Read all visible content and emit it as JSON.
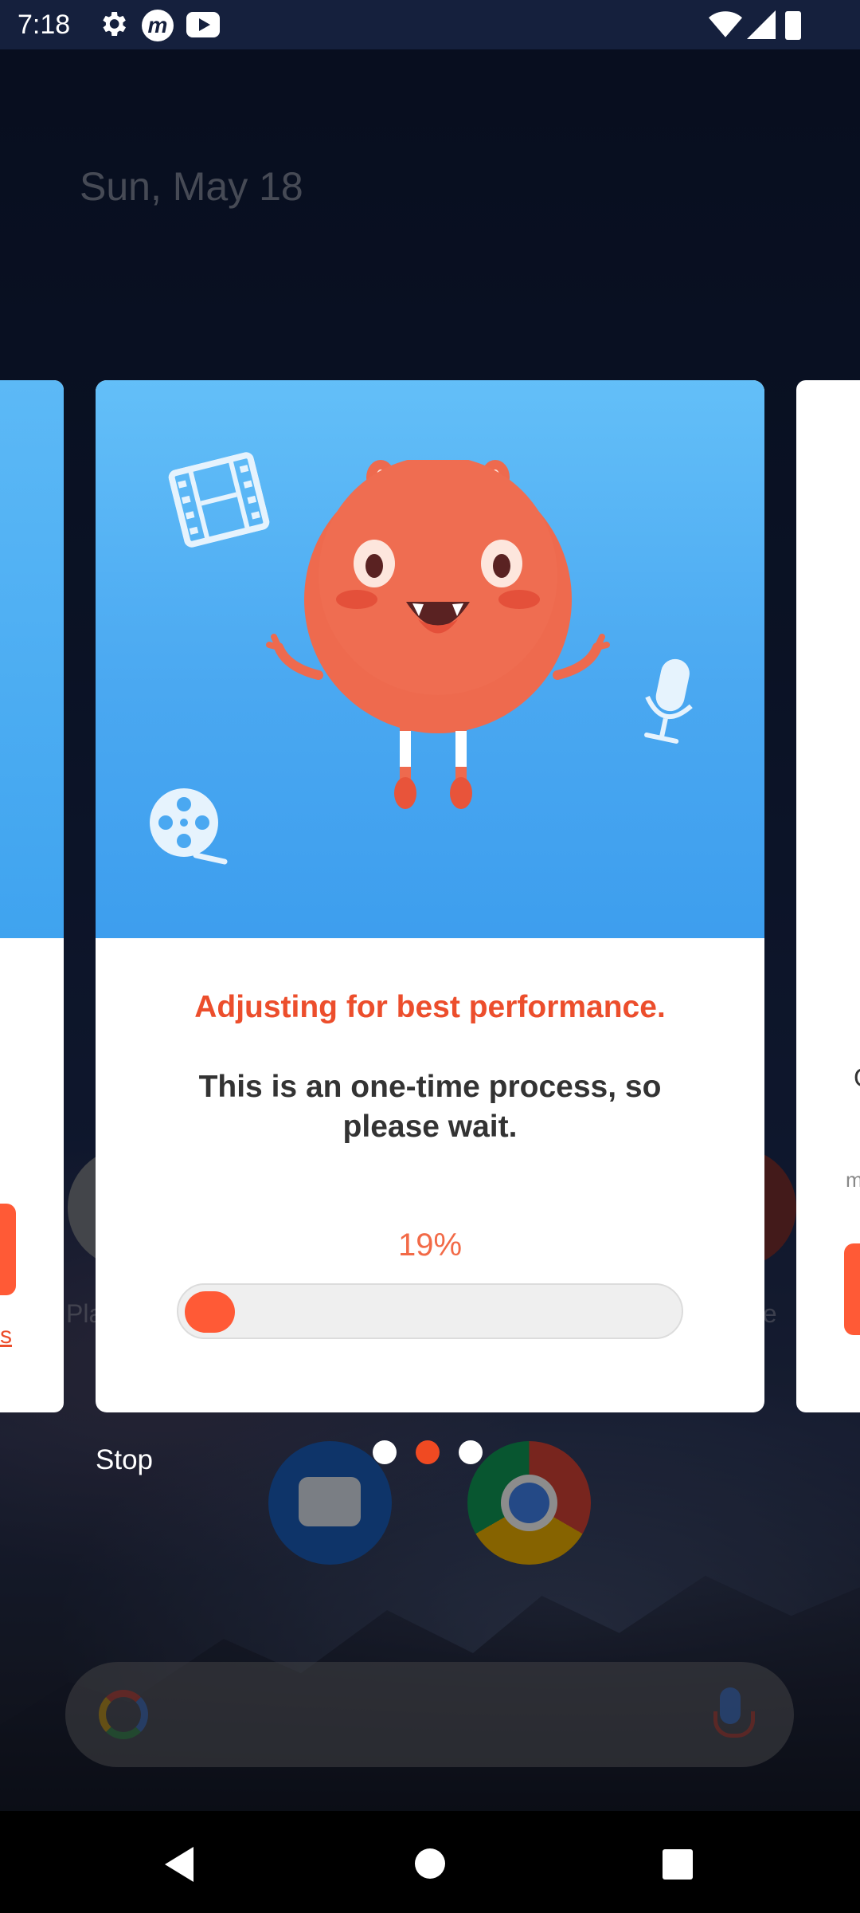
{
  "status_bar": {
    "time": "7:18",
    "icons": [
      "gear-icon",
      "messenger-m-icon",
      "youtube-icon",
      "wifi-icon",
      "signal-icon",
      "battery-icon"
    ]
  },
  "home": {
    "date": "Sun, May 18",
    "left_label_fragment": "Pla",
    "right_label_fragment": "be"
  },
  "left_card": {
    "link_fragment": "s"
  },
  "right_card": {
    "text_fragment": "C",
    "text_fragment_2": "m"
  },
  "dialog": {
    "headline": "Adjusting for best performance.",
    "subtext": "This is an one-time process, so please wait.",
    "progress_label": "19%",
    "progress_value": 0.19,
    "stop_label": "Stop",
    "page_index": 1,
    "page_count": 3
  },
  "colors": {
    "accent": "#ec4e2c",
    "progress": "#ff5a36",
    "hero_blue": "#4aa8f1",
    "dot_active": "#f04a22",
    "dot_inactive": "#ffffff"
  }
}
